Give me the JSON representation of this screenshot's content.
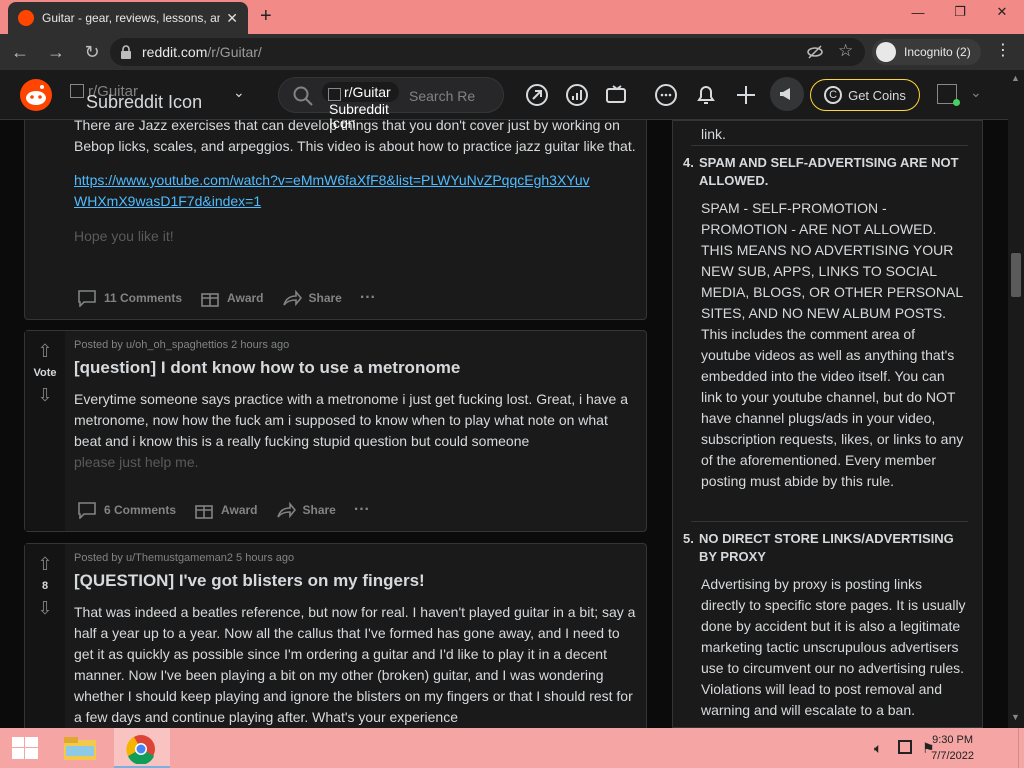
{
  "browser": {
    "tab_title": "Guitar - gear, reviews, lessons, an",
    "url_domain": "reddit.com",
    "url_path": "/r/Guitar/",
    "incognito_label": "Incognito (2)"
  },
  "reddit_header": {
    "subreddit_name": "r/Guitar",
    "subreddit_icon_alt": "Subreddit Icon",
    "search_chip": "r/Guitar",
    "search_chip_alt": "Subreddit Icon",
    "search_placeholder": "Search Re",
    "coins_label": "Get Coins"
  },
  "posts": [
    {
      "text": "There are Jazz exercises that can develop things that you don't cover just by working on Bebop licks, scales, and arpeggios. This video is about how to practice jazz guitar like that.",
      "link": "https://www.youtube.com/watch?v=eMmW6faXfF8&list=PLWYuNvZPqqcEgh3XYuvWHXmX9wasD1F7d&index=1",
      "faded_text": "Hope you like it!",
      "comments": "11 Comments",
      "award": "Award",
      "share": "Share"
    },
    {
      "meta": "Posted by u/oh_oh_spaghettios 2 hours ago",
      "vote": "Vote",
      "title": "[question] I dont know how to use a metronome",
      "text": "Everytime someone says practice with a metronome i just get fucking lost. Great, i have a metronome, now how the fuck am i supposed to know when to play what note on what beat and i know this is a really fucking stupid question but could someone",
      "faded_text": "please just help me.",
      "comments": "6 Comments",
      "award": "Award",
      "share": "Share"
    },
    {
      "meta": "Posted by u/Themustgameman2 5 hours ago",
      "vote": "8",
      "title": "[QUESTION] I've got blisters on my fingers!",
      "text": "That was indeed a beatles reference, but now for real. I haven't played guitar in a bit; say a half a year up to a year. Now all the callus that I've formed has gone away, and I need to get it as quickly as possible since I'm ordering a guitar and I'd like to play it in a decent manner. Now I've been playing a bit on my other (broken) guitar, and I was wondering whether I should keep playing and ignore the blisters on my fingers or that I should rest for a few days and continue playing after. What's your experience"
    }
  ],
  "sidebar": {
    "top_text": "link.",
    "rules": [
      {
        "number": "4.",
        "title": "SPAM AND SELF-ADVERTISING ARE NOT ALLOWED.",
        "text": "SPAM - SELF-PROMOTION - PROMOTION - ARE NOT ALLOWED. THIS MEANS NO ADVERTISING YOUR NEW SUB, APPS, LINKS TO SOCIAL MEDIA, BLOGS, OR OTHER PERSONAL SITES, AND NO NEW ALBUM POSTS. This includes the comment area of youtube videos as well as anything that's embedded into the video itself. You can link to your youtube channel, but do NOT have channel plugs/ads in your video, subscription requests, likes, or links to any of the aforementioned. Every member posting must abide by this rule."
      },
      {
        "number": "5.",
        "title": "NO DIRECT STORE LINKS/ADVERTISING BY PROXY",
        "text": "Advertising by proxy is posting links directly to specific store pages. It is usually done by accident but it is also a legitimate marketing tactic unscrupulous advertisers use to circumvent our no advertising rules. Violations will lead to post removal and warning and will escalate to a ban."
      }
    ]
  },
  "taskbar": {
    "time": "9:30 PM",
    "date": "7/7/2022"
  }
}
